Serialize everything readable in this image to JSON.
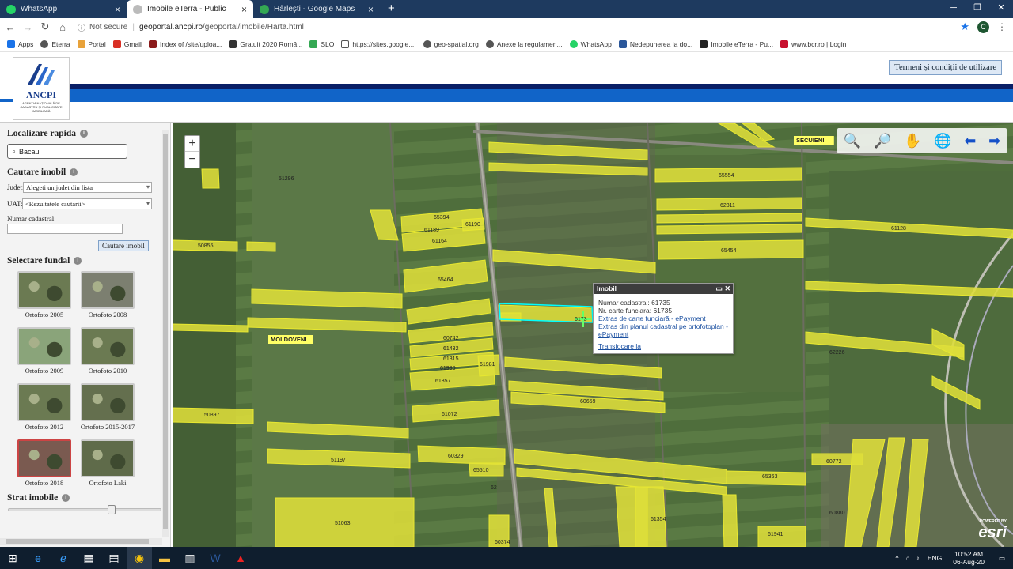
{
  "browser": {
    "tabs": [
      {
        "title": "WhatsApp",
        "color": "#25d366"
      },
      {
        "title": "Imobile eTerra - Public",
        "color": "#888888"
      },
      {
        "title": "Hârlești - Google Maps",
        "color": "#34a853"
      }
    ],
    "active_tab": 1,
    "security": "Not secure",
    "url_host": "geoportal.ancpi.ro",
    "url_path": "/geoportal/imobile/Harta.html",
    "profile_initial": "C",
    "bookmarks": [
      "Apps",
      "Eterra",
      "Portal",
      "Gmail",
      "Index of /site/uploa...",
      "Gratuit 2020 Romă...",
      "SLO",
      "https://sites.google....",
      "geo-spatial.org",
      "Anexe la regulamen...",
      "WhatsApp",
      "Nedepunerea la do...",
      "Imobile eTerra - Pu...",
      "www.bcr.ro | Login"
    ]
  },
  "header": {
    "logo_text": "ANCPI",
    "logo_sub": "AGENȚIA NAȚIONALĂ DE CADASTRU ȘI PUBLICITATE IMOBILIARĂ",
    "terms_button": "Termeni și condiții de utilizare"
  },
  "panel": {
    "quick_title": "Localizare rapida",
    "quick_value": "Bacau",
    "search_title": "Cautare imobil",
    "judet_label": "Judet:",
    "judet_value": "Alegeti un judet din lista",
    "uat_label": "UAT:",
    "uat_value": "<Rezultatele cautarii>",
    "cad_label": "Numar cadastral:",
    "search_button": "Cautare imobil",
    "bg_title": "Selectare fundal",
    "backgrounds": [
      "Ortofoto 2005",
      "Ortofoto 2008",
      "Ortofoto 2009",
      "Ortofoto 2010",
      "Ortofoto 2012",
      "Ortofoto 2015-2017",
      "Ortofoto 2018",
      "Ortofoto Laki"
    ],
    "selected_background": 6,
    "layer_title": "Strat imobile"
  },
  "map": {
    "place_labels": [
      "SECUIENI",
      "MOLDOVENI"
    ],
    "parcel_labels": [
      "51296",
      "65394",
      "61189",
      "61190",
      "61164",
      "50855",
      "65464",
      "60742",
      "61432",
      "61315",
      "61980",
      "61981",
      "61857",
      "61072",
      "60329",
      "65510",
      "62",
      "51197",
      "50897",
      "51063",
      "60374",
      "65554",
      "62311",
      "61128",
      "65454",
      "62226",
      "60659",
      "60772",
      "65363",
      "60880",
      "61354",
      "61941",
      "6173"
    ],
    "popup": {
      "title": "Imobil",
      "cad_line": "Numar cadastral: 61735",
      "cf_line": "Nr. carte funciara: 61735",
      "link1": "Extras de carte funciară - ePayment",
      "link2": "Extras din planul cadastral pe ortofotoplan - ePayment",
      "link3": "Transfocare la"
    },
    "attribution_top": "POWERED BY",
    "attribution": "esri"
  },
  "taskbar": {
    "lang": "ENG",
    "time": "10:52 AM",
    "date": "06-Aug-20"
  }
}
